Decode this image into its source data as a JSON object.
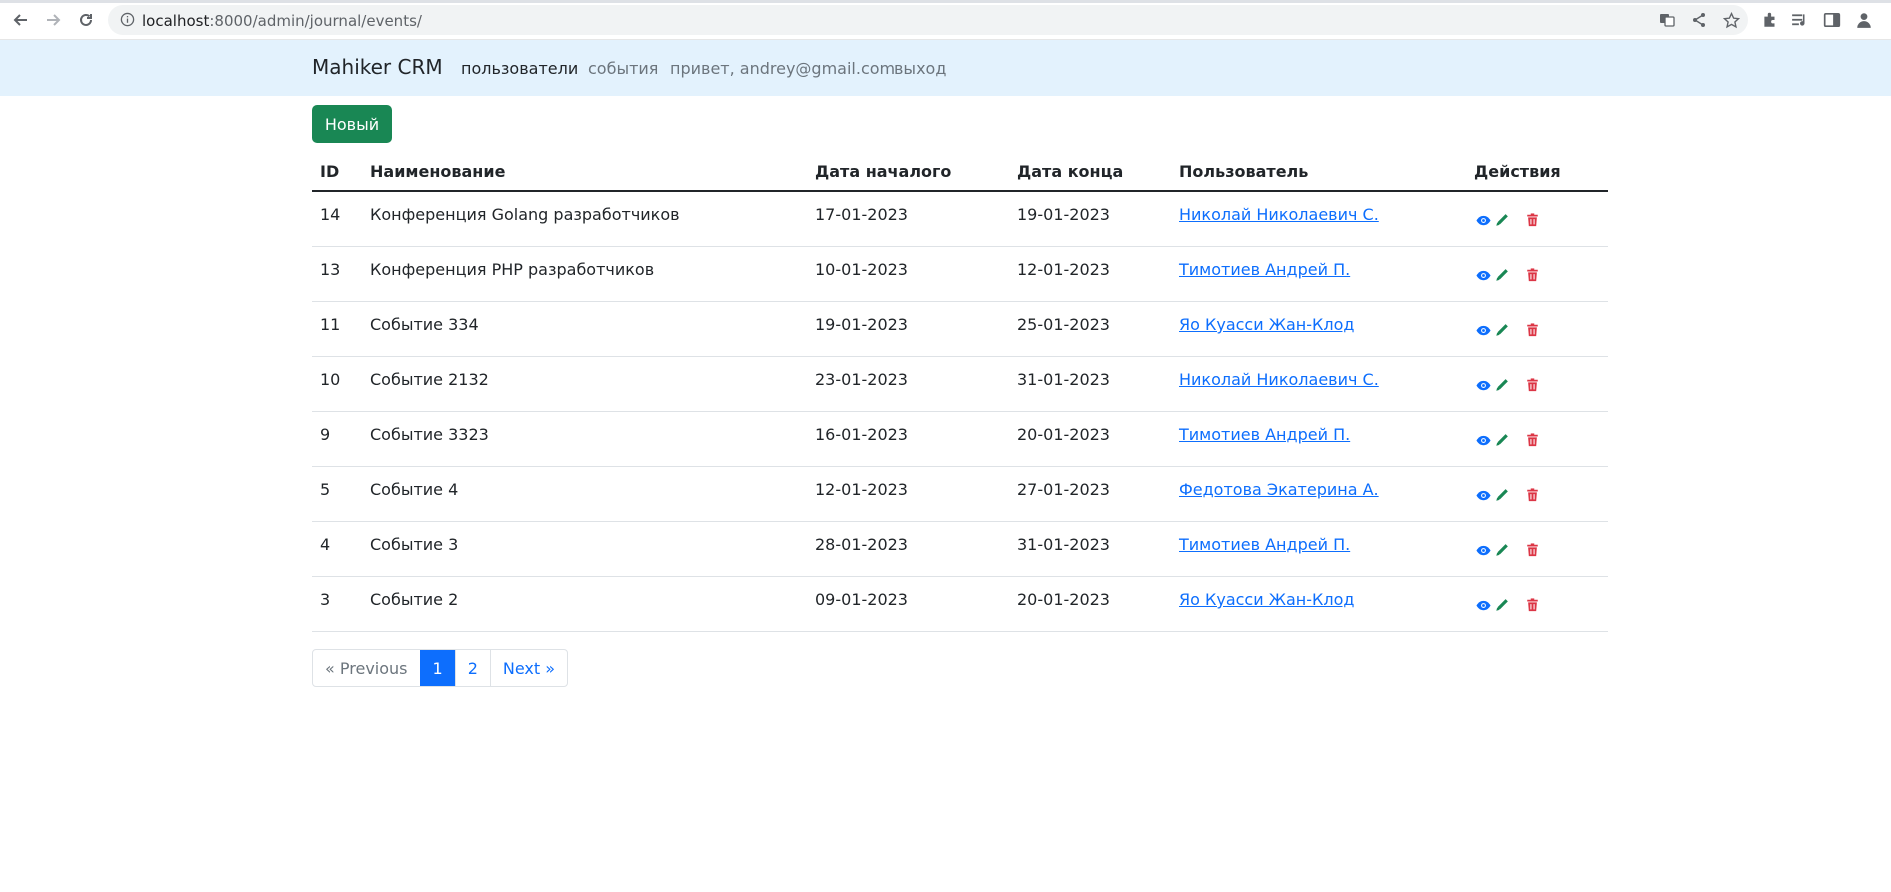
{
  "browser": {
    "url_host": "localhost",
    "url_rest": ":8000/admin/journal/events/"
  },
  "navbar": {
    "brand": "Mahiker CRM",
    "links": [
      {
        "label": "пользователи",
        "active": true
      },
      {
        "label": "события",
        "active": false
      },
      {
        "label": "привет, andrey@gmail.com",
        "active": false
      },
      {
        "label": "выход",
        "active": false
      }
    ]
  },
  "new_button": "Новый",
  "table": {
    "headers": {
      "id": "ID",
      "name": "Наименование",
      "start": "Дата началого",
      "end": "Дата конца",
      "user": "Пользователь",
      "actions": "Действия"
    },
    "rows": [
      {
        "id": "14",
        "name": "Конференция Golang разработчиков",
        "start": "17-01-2023",
        "end": "19-01-2023",
        "user": "Николай Николаевич С."
      },
      {
        "id": "13",
        "name": "Конференция PHP разработчиков",
        "start": "10-01-2023",
        "end": "12-01-2023",
        "user": "Тимотиев Андрей П."
      },
      {
        "id": "11",
        "name": "Событие 334",
        "start": "19-01-2023",
        "end": "25-01-2023",
        "user": "Яо Куасси Жан-Клод"
      },
      {
        "id": "10",
        "name": "Событие 2132",
        "start": "23-01-2023",
        "end": "31-01-2023",
        "user": "Николай Николаевич С."
      },
      {
        "id": "9",
        "name": "Событие 3323",
        "start": "16-01-2023",
        "end": "20-01-2023",
        "user": "Тимотиев Андрей П."
      },
      {
        "id": "5",
        "name": "Событие 4",
        "start": "12-01-2023",
        "end": "27-01-2023",
        "user": "Федотова Экатерина А."
      },
      {
        "id": "4",
        "name": "Событие 3",
        "start": "28-01-2023",
        "end": "31-01-2023",
        "user": "Тимотиев Андрей П."
      },
      {
        "id": "3",
        "name": "Событие 2",
        "start": "09-01-2023",
        "end": "20-01-2023",
        "user": "Яо Куасси Жан-Клод"
      }
    ],
    "row_actions": [
      "eye-icon",
      "pencil-icon",
      "trash-icon"
    ]
  },
  "pagination": {
    "previous": "« Previous",
    "pages": [
      "1",
      "2"
    ],
    "current": "1",
    "next": "Next »"
  },
  "colors": {
    "navbar_bg": "#e3f2fd",
    "success": "#198754",
    "primary": "#0d6efd",
    "danger": "#dc3545"
  }
}
